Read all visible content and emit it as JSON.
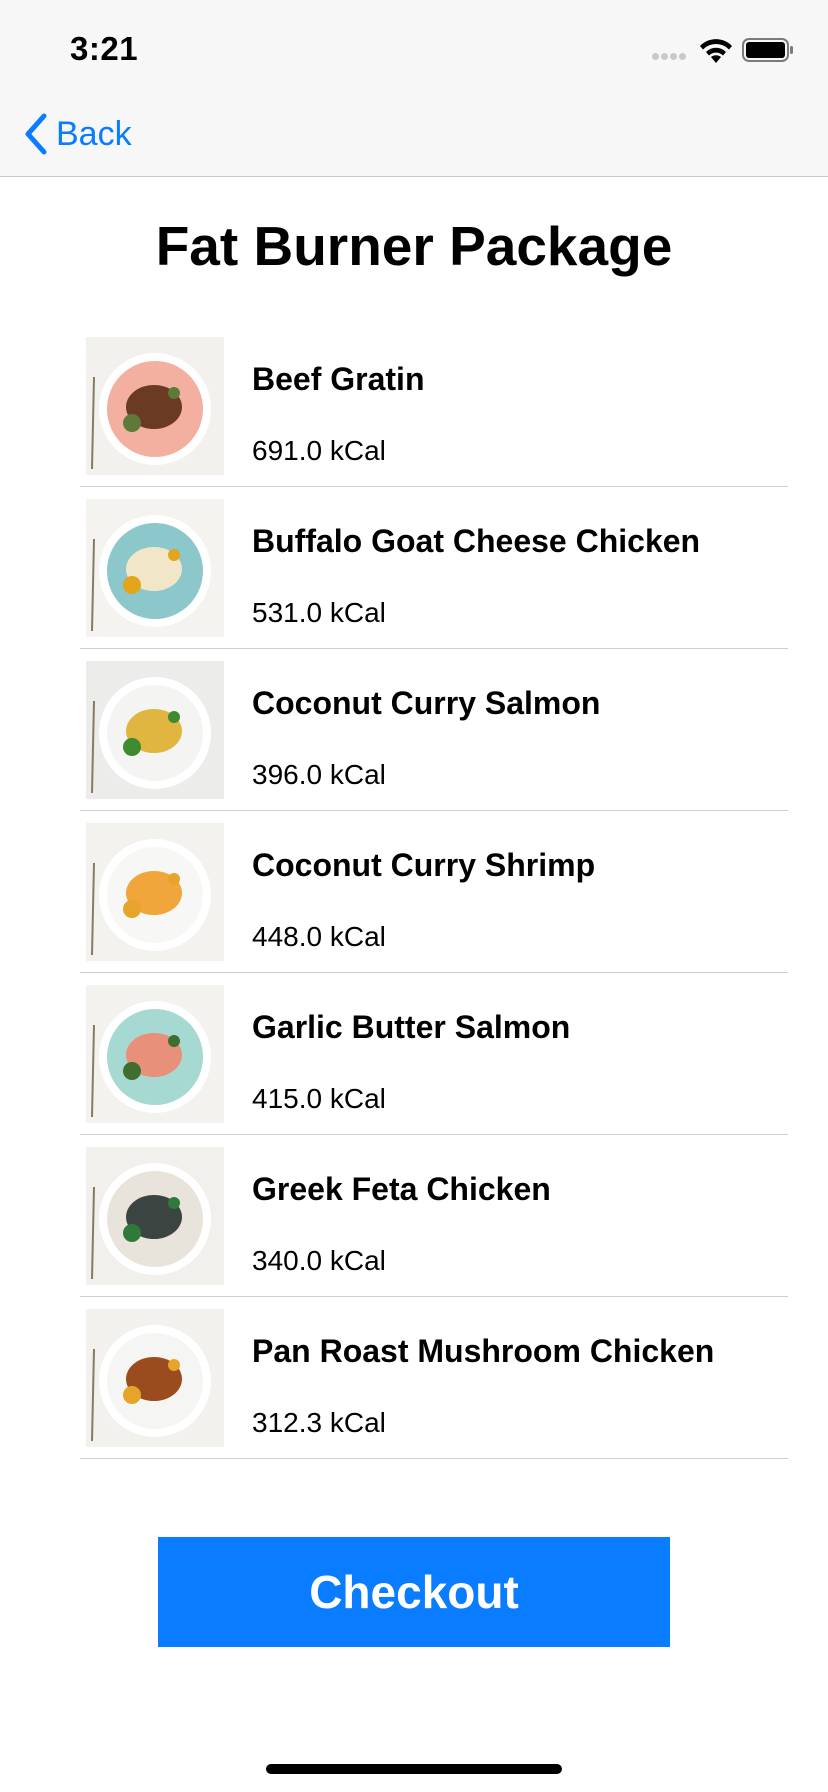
{
  "status_bar": {
    "time": "3:21"
  },
  "nav": {
    "back_label": "Back"
  },
  "page_title": "Fat Burner Package",
  "meals": [
    {
      "name": "Beef Gratin",
      "kcal": "691.0 kCal",
      "plate_color": "#f3b0a0",
      "food_color": "#6b3a22",
      "accent_color": "#5d7a3a",
      "bg_color": "#f3f1ee"
    },
    {
      "name": "Buffalo Goat Cheese Chicken",
      "kcal": "531.0 kCal",
      "plate_color": "#8cc7cc",
      "food_color": "#f1e6c8",
      "accent_color": "#e3a51c",
      "bg_color": "#f5f3ef"
    },
    {
      "name": "Coconut Curry Salmon",
      "kcal": "396.0 kCal",
      "plate_color": "#f4f4f2",
      "food_color": "#e0b640",
      "accent_color": "#3e8a2f",
      "bg_color": "#ececea"
    },
    {
      "name": "Coconut Curry Shrimp",
      "kcal": "448.0 kCal",
      "plate_color": "#f7f7f5",
      "food_color": "#f0a63a",
      "accent_color": "#e6a52a",
      "bg_color": "#f4f2ee"
    },
    {
      "name": "Garlic Butter Salmon",
      "kcal": "415.0 kCal",
      "plate_color": "#a6d9d1",
      "food_color": "#e8907a",
      "accent_color": "#3f6e30",
      "bg_color": "#f4f2ee"
    },
    {
      "name": "Greek Feta Chicken",
      "kcal": "340.0 kCal",
      "plate_color": "#e8e4dc",
      "food_color": "#3b4440",
      "accent_color": "#2f7a3a",
      "bg_color": "#f1f0ec"
    },
    {
      "name": "Pan Roast Mushroom Chicken",
      "kcal": "312.3 kCal",
      "plate_color": "#f5f5f3",
      "food_color": "#9a4c1e",
      "accent_color": "#e6a52a",
      "bg_color": "#f3f1ed"
    }
  ],
  "checkout_label": "Checkout"
}
